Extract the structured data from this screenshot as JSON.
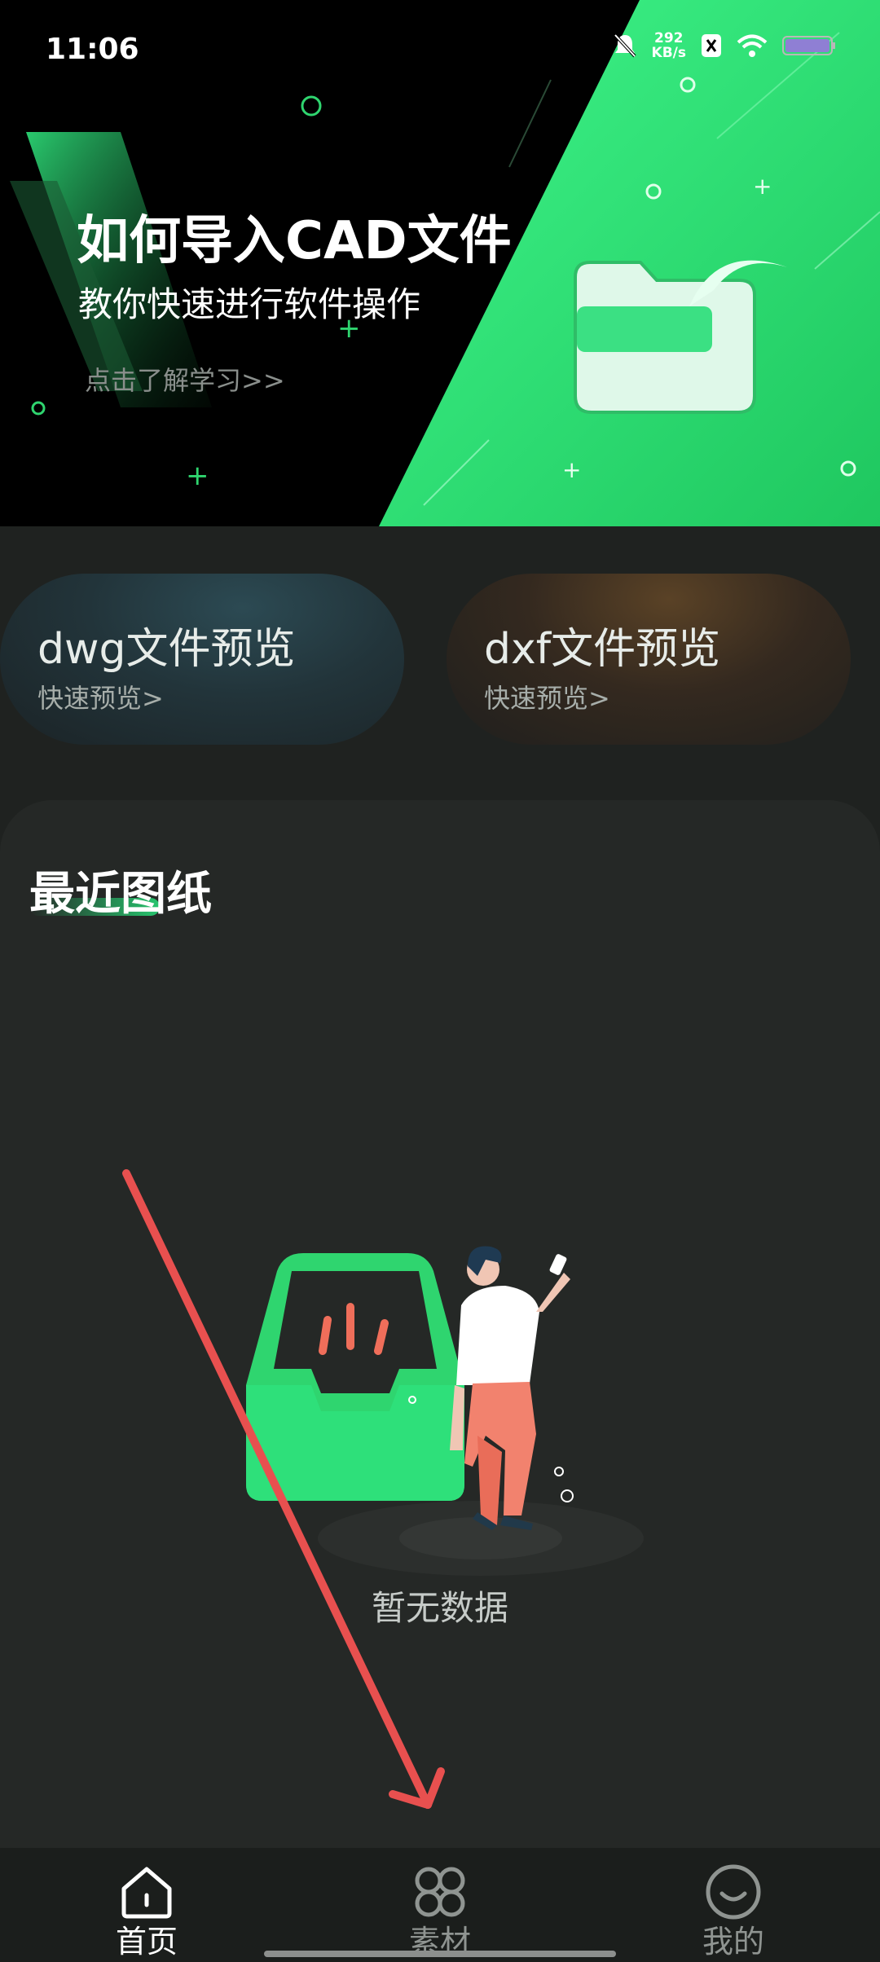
{
  "status_bar": {
    "time": "11:06",
    "net_speed_value": "292",
    "net_speed_unit": "KB/s",
    "icons": [
      "bell-muted-icon",
      "sim-icon",
      "wifi-icon",
      "battery-icon"
    ]
  },
  "banner": {
    "title": "如何导入CAD文件",
    "subtitle": "教你快速进行软件操作",
    "link": "点击了解学习>>",
    "accent_color": "#2fd56f"
  },
  "quick_actions": [
    {
      "title": "dwg文件预览",
      "subtitle": "快速预览>"
    },
    {
      "title": "dxf文件预览",
      "subtitle": "快速预览>"
    }
  ],
  "recent": {
    "title": "最近图纸",
    "empty_text": "暂无数据"
  },
  "nav": {
    "items": [
      {
        "label": "首页",
        "icon": "home-icon",
        "active": true
      },
      {
        "label": "素材",
        "icon": "grid-icon",
        "active": false
      },
      {
        "label": "我的",
        "icon": "smile-icon",
        "active": false
      }
    ]
  },
  "colors": {
    "background": "#1f2220",
    "panel": "#252826",
    "accent": "#2fd56f",
    "annotation_arrow": "#e8504f"
  }
}
